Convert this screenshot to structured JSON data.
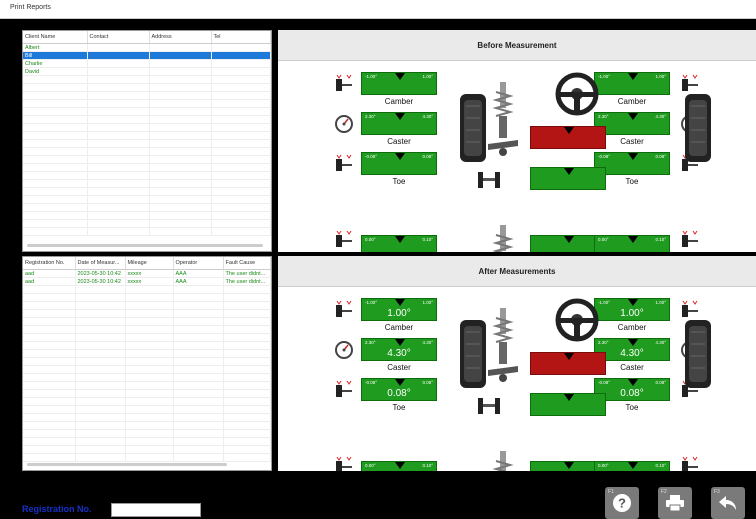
{
  "window": {
    "title": "Print Reports"
  },
  "clients": {
    "columns": [
      "Client Name",
      "Contact",
      "Address",
      "Tel"
    ],
    "rows": [
      [
        "Albert",
        "",
        "",
        ""
      ],
      [
        "Bill",
        "",
        "",
        ""
      ],
      [
        "Charlie",
        "",
        "",
        ""
      ],
      [
        "David",
        "",
        "",
        ""
      ]
    ],
    "selected_index": 1
  },
  "registrations": {
    "columns": [
      "Registration No.",
      "Date of Measur...",
      "Mileage",
      "Operator",
      "Fault Cause"
    ],
    "rows": [
      [
        "aad",
        "2023-05-30 10:42",
        "xxxxx",
        "AAA",
        "The user didnt..."
      ],
      [
        "aad",
        "2023-05-30 10:42",
        "xxxxx",
        "AAA",
        "The user didnt..."
      ]
    ]
  },
  "before": {
    "title": "Before Measurement",
    "camber_label": "Camber",
    "caster_label": "Caster",
    "toe_label": "Toe",
    "left": {
      "camber": {
        "min": "-1.00°",
        "max": "1.00°"
      },
      "caster": {
        "min": "2.30°",
        "max": "4.30°"
      },
      "toe": {
        "min": "-0.08°",
        "max": "0.08°"
      }
    },
    "right": {
      "camber": {
        "min": "-1.00°",
        "max": "1.00°"
      },
      "caster": {
        "min": "2.30°",
        "max": "4.30°"
      },
      "toe": {
        "min": "-0.08°",
        "max": "0.08°"
      }
    },
    "rear_left": {
      "min": "0.00°",
      "max": "0.10°"
    },
    "rear_right": {
      "min": "0.00°",
      "max": "0.10°"
    }
  },
  "after": {
    "title": "After Measurements",
    "camber_label": "Camber",
    "caster_label": "Caster",
    "toe_label": "Toe",
    "left": {
      "camber": {
        "min": "-1.00°",
        "max": "1.00°",
        "value": "1.00°"
      },
      "caster": {
        "min": "2.30°",
        "max": "4.30°",
        "value": "4.30°"
      },
      "toe": {
        "min": "-0.08°",
        "max": "0.08°",
        "value": "0.08°"
      }
    },
    "right": {
      "camber": {
        "min": "-1.00°",
        "max": "1.00°",
        "value": "1.00°"
      },
      "caster": {
        "min": "2.30°",
        "max": "4.30°",
        "value": "4.30°"
      },
      "toe": {
        "min": "-0.08°",
        "max": "0.08°",
        "value": "0.08°"
      }
    },
    "rear_left": {
      "min": "0.00°",
      "max": "0.10°"
    },
    "rear_right": {
      "min": "0.00°",
      "max": "0.10°"
    }
  },
  "footer": {
    "registration_label": "Registration No.",
    "registration_value": "",
    "help_key": "F1",
    "print_key": "F2",
    "back_key": "F3"
  },
  "icons": [
    "help-icon",
    "printer-icon",
    "back-arrow-icon"
  ],
  "colors": {
    "in_range": "#1f9b1f",
    "out_of_range": "#b31515",
    "selection": "#1e7ad8"
  }
}
